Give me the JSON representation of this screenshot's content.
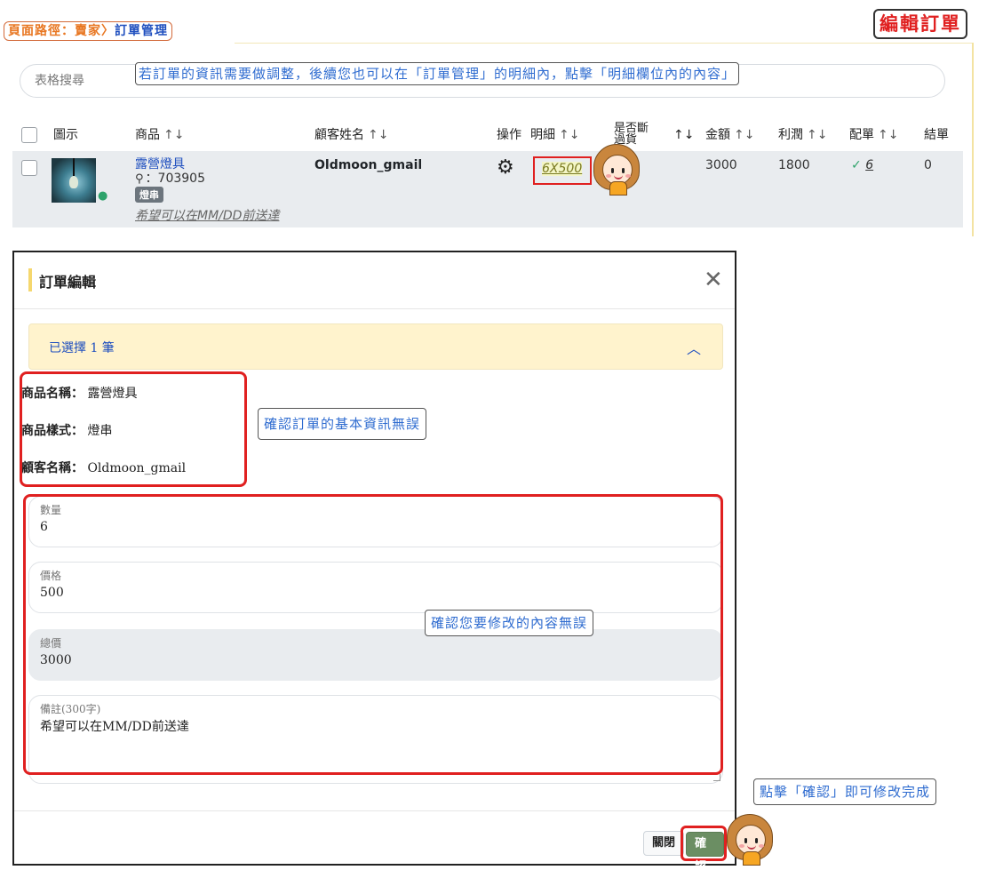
{
  "breadcrumb": {
    "prefix": "頁面路徑：賣家",
    "separator": "〉",
    "current": "訂單管理"
  },
  "page_tag": "編輯訂單",
  "table": {
    "search_placeholder": "表格搜尋",
    "callout": "若訂單的資訊需要做調整，後續您也可以在「訂單管理」的明細內，點擊「明細欄位內的內容」",
    "sort_icon": "↑↓",
    "columns": {
      "image": "圖示",
      "product": "商品",
      "customer": "顧客姓名",
      "action": "操作",
      "detail": "明細",
      "out_of_stock_l1": "是否斷",
      "out_of_stock_l2": "過貨",
      "amount": "金額",
      "profit": "利潤",
      "allocation": "配單",
      "settled": "結單"
    },
    "row": {
      "product_name": "露營燈具",
      "sku_icon": "⚲",
      "sku": "：703905",
      "variant": "燈串",
      "note": "希望可以在MM/DD前送達",
      "customer": "Oldmoon_gmail",
      "action_icon": "gear-icon",
      "detail": "6X500",
      "amount": "3000",
      "profit": "1800",
      "allocation_check": "✓",
      "allocation": "6",
      "settled": "0"
    }
  },
  "modal": {
    "title": "訂單編輯",
    "close_glyph": "✕",
    "accordion": {
      "title": "已選擇 1 筆",
      "chevron": "︿"
    },
    "info": {
      "product_name_label": "商品名稱：",
      "product_name": "露營燈具",
      "product_style_label": "商品樣式：",
      "product_style": "燈串",
      "customer_label": "顧客名稱：",
      "customer": "Oldmoon_gmail"
    },
    "callout_info": "確認訂單的基本資訊無誤",
    "fields": {
      "quantity_label": "數量",
      "quantity": "6",
      "price_label": "價格",
      "price": "500",
      "total_label": "總價",
      "total": "3000",
      "note_label": "備註(300字)",
      "note": "希望可以在MM/DD前送達"
    },
    "callout_edit": "確認您要修改的內容無誤",
    "buttons": {
      "close": "關閉",
      "confirm": "確認"
    }
  },
  "callout_confirm": "點擊「確認」即可修改完成",
  "colors": {
    "accent_red": "#e02020",
    "link_blue": "#1f4fbf",
    "confirm_green": "#6b8e63",
    "highlight_yellow": "#fff3cd"
  }
}
